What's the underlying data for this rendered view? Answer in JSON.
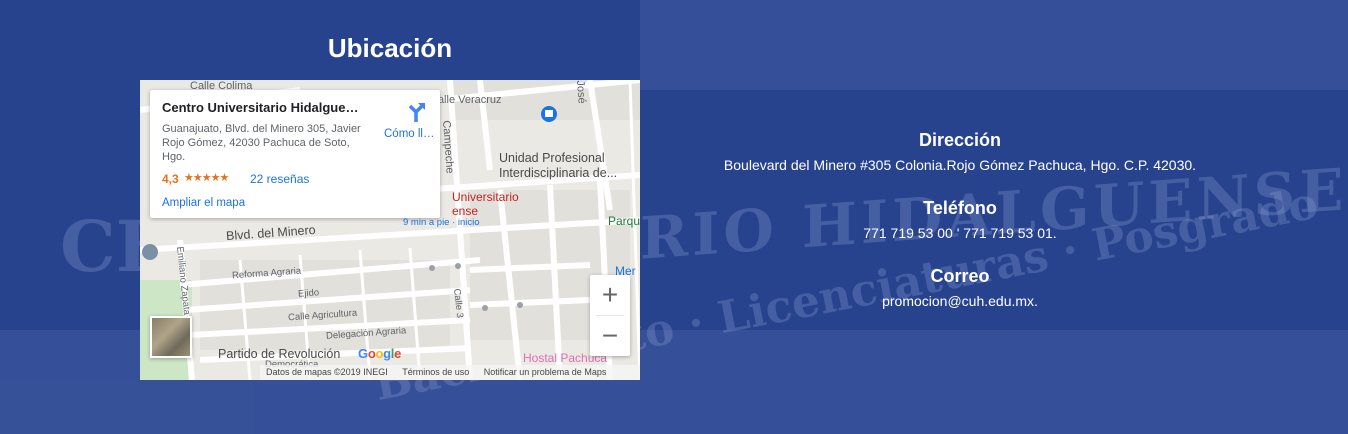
{
  "location": {
    "title": "Ubicación"
  },
  "map": {
    "place_name": "Centro Universitario Hidalguense",
    "address": "Guanajuato, Blvd. del Minero 305, Javier Rojo Gómez, 42030 Pachuca de Soto, Hgo.",
    "rating": "4,3",
    "stars": "★★★★★",
    "reviews": "22 reseñas",
    "enlarge_map": "Ampliar el mapa",
    "directions_label": "Cómo llegar",
    "zoom_in": "+",
    "zoom_out": "−",
    "labels": {
      "calle_colima": "Calle Colima",
      "calle_veracruz": "Calle Veracruz",
      "campeche": "Campeche",
      "jose": "José",
      "unidad_profesional_1": "Unidad Profesional",
      "unidad_profesional_2": "Interdisciplinaria de...",
      "cuh_poi_1": "Universitario",
      "cuh_poi_2": "ense",
      "walk_time": "9 min a pie · inicio",
      "parque": "Parqu",
      "blvd_minero": "Blvd. del Minero",
      "reforma_agraria": "Reforma Agraria",
      "ejido": "Ejido",
      "calle_agricultura": "Calle Agricultura",
      "delegacion_agraria": "Delegación Agraria",
      "calle_3": "Calle 3",
      "emiliano_zapata": "Emiliano Zapata",
      "partido_revolucion": "Partido de Revolución",
      "democratica": "Democrática",
      "hostal_pachuca": "Hostal Pachuca",
      "mer": "Mer"
    },
    "google": "Google",
    "footer_data": "Datos de mapas ©2019 INEGI",
    "footer_terms": "Términos de uso",
    "footer_report": "Notificar un problema de Maps"
  },
  "contact": {
    "address_heading": "Dirección",
    "address_value": "Boulevard del Minero #305 Colonia.Rojo Gómez Pachuca, Hgo. C.P. 42030.",
    "phone_heading": "Teléfono",
    "phone_value": "771 719 53 00 ' 771 719 53 01.",
    "email_heading": "Correo",
    "email_value": "promocion@cuh.edu.mx."
  },
  "background": {
    "sign_text": "RIO HIDALGUENSE",
    "sign_left": "CE",
    "bottom_text": "Bachillerato · Licenciaturas · Posgrado"
  },
  "colors": {
    "background": "#27438e",
    "map_link": "#1a73e8",
    "rating": "#e7711b"
  }
}
